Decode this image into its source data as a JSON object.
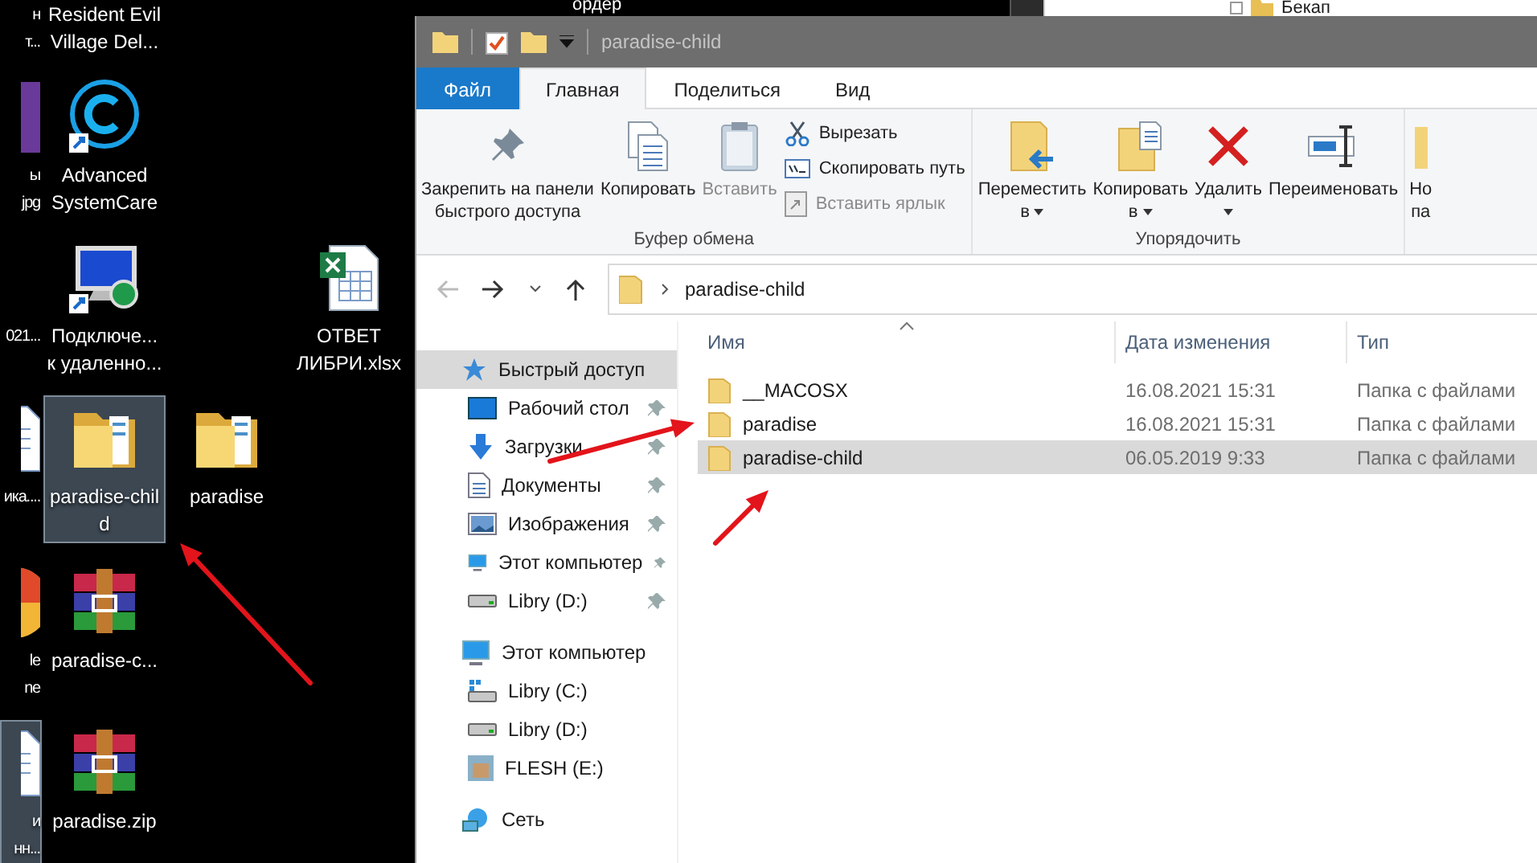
{
  "desktop": {
    "icons": [
      {
        "kind": "none",
        "label": [
          "н",
          "т..."
        ],
        "selected": false
      },
      {
        "kind": "image",
        "label": [
          "ы",
          "jpg"
        ],
        "selected": false
      },
      {
        "kind": "none",
        "label": [
          "021..."
        ],
        "selected": false
      },
      {
        "kind": "document",
        "label": [
          "ика...."
        ],
        "selected": false
      },
      {
        "kind": "circle",
        "label": [
          "le",
          "ne"
        ],
        "selected": false
      },
      {
        "kind": "document",
        "label": [
          "и",
          "нн..."
        ],
        "selected": true
      },
      {
        "kind": "none",
        "label": [
          "Resident Evil",
          "Village Del..."
        ],
        "selected": false
      },
      {
        "kind": "app",
        "label": [
          "Advanced",
          "SystemCare"
        ],
        "selected": false
      },
      {
        "kind": "remote",
        "label": [
          "Подключе...",
          "к удаленно..."
        ],
        "selected": false
      },
      {
        "kind": "folder",
        "label": [
          "paradise-chil",
          "d"
        ],
        "selected": true
      },
      {
        "kind": "archive",
        "label": [
          "paradise-c..."
        ],
        "selected": false
      },
      {
        "kind": "archive",
        "label": [
          "paradise.zip"
        ],
        "selected": false
      },
      {
        "kind": "folder",
        "label": [
          "paradise"
        ],
        "selected": false
      },
      {
        "kind": "excel",
        "label": [
          "ОТВЕТ",
          "ЛИБРИ.xlsx"
        ],
        "selected": false
      }
    ]
  },
  "background_windows": {
    "left_text": "ордер",
    "tree_item": "Бекап"
  },
  "explorer": {
    "title": "paradise-child",
    "tabs": [
      {
        "kind": "file",
        "label": "Файл",
        "selected": false
      },
      {
        "kind": "tab",
        "label": "Главная",
        "selected": true
      },
      {
        "kind": "tab",
        "label": "Поделиться",
        "selected": false
      },
      {
        "kind": "tab",
        "label": "Вид",
        "selected": false
      }
    ],
    "ribbon": {
      "groups": [
        {
          "label": "Буфер обмена",
          "buttons": [
            {
              "kind": "pin",
              "lines": [
                "Закрепить на панели",
                "быстрого доступа"
              ],
              "disabled": false,
              "dropdown": false
            },
            {
              "kind": "copy",
              "lines": [
                "Копировать"
              ],
              "disabled": false,
              "dropdown": false
            },
            {
              "kind": "paste",
              "lines": [
                "Вставить"
              ],
              "disabled": true,
              "dropdown": false
            },
            {
              "kind": "stack",
              "items": [
                {
                  "kind": "cut",
                  "label": "Вырезать",
                  "disabled": false
                },
                {
                  "kind": "copy-path",
                  "label": "Скопировать путь",
                  "disabled": false
                },
                {
                  "kind": "paste-shortcut",
                  "label": "Вставить ярлык",
                  "disabled": true
                }
              ]
            }
          ]
        },
        {
          "label": "Упорядочить",
          "buttons": [
            {
              "kind": "move",
              "lines": [
                "Переместить",
                "в"
              ],
              "disabled": false,
              "dropdown": true
            },
            {
              "kind": "copy-to",
              "lines": [
                "Копировать",
                "в"
              ],
              "disabled": false,
              "dropdown": true
            },
            {
              "kind": "delete",
              "lines": [
                "Удалить"
              ],
              "disabled": false,
              "dropdown": true
            },
            {
              "kind": "rename",
              "lines": [
                "Переименовать"
              ],
              "disabled": false,
              "dropdown": false
            }
          ]
        },
        {
          "buttons": [
            {
              "kind": "new",
              "lines": [
                "Но",
                "па"
              ],
              "disabled": false,
              "dropdown": false
            }
          ]
        }
      ]
    },
    "address": {
      "path": "paradise-child",
      "back_disabled": true
    },
    "nav": [
      {
        "kind": "quick",
        "label": "Быстрый доступ",
        "selected": true,
        "children": [
          {
            "kind": "desktop",
            "label": "Рабочий стол",
            "pinned": true,
            "selected": false
          },
          {
            "kind": "downloads",
            "label": "Загрузки",
            "pinned": true,
            "selected": false
          },
          {
            "kind": "documents",
            "label": "Документы",
            "pinned": true,
            "selected": false
          },
          {
            "kind": "pictures",
            "label": "Изображения",
            "pinned": true,
            "selected": false
          },
          {
            "kind": "computer",
            "label": "Этот компьютер",
            "pinned": true,
            "selected": false
          },
          {
            "kind": "drive",
            "label": "Libry (D:)",
            "pinned": true,
            "selected": false
          }
        ]
      },
      {
        "kind": "computer",
        "label": "Этот компьютер",
        "selected": false,
        "children": [
          {
            "kind": "system-drive",
            "label": "Libry (C:)",
            "pinned": false,
            "selected": false
          },
          {
            "kind": "drive",
            "label": "Libry (D:)",
            "pinned": false,
            "selected": false
          },
          {
            "kind": "usb",
            "label": "FLESH (E:)",
            "pinned": false,
            "selected": false
          }
        ]
      },
      {
        "kind": "network",
        "label": "Сеть",
        "selected": false
      }
    ],
    "files": {
      "columns": [
        {
          "label": "Имя",
          "sorted": true
        },
        {
          "label": "Дата изменения",
          "sorted": false
        },
        {
          "label": "Тип",
          "sorted": false
        }
      ],
      "rows": [
        {
          "name": "__MACOSX",
          "date": "16.08.2021 15:31",
          "type": "Папка с файлами",
          "selected": false
        },
        {
          "name": "paradise",
          "date": "16.08.2021 15:31",
          "type": "Папка с файлами",
          "selected": false
        },
        {
          "name": "paradise-child",
          "date": "06.05.2019 9:33",
          "type": "Папка с файлами",
          "selected": true
        }
      ]
    }
  },
  "annotations": [
    {
      "kind": "arrow"
    },
    {
      "kind": "arrow"
    },
    {
      "kind": "arrow"
    }
  ]
}
